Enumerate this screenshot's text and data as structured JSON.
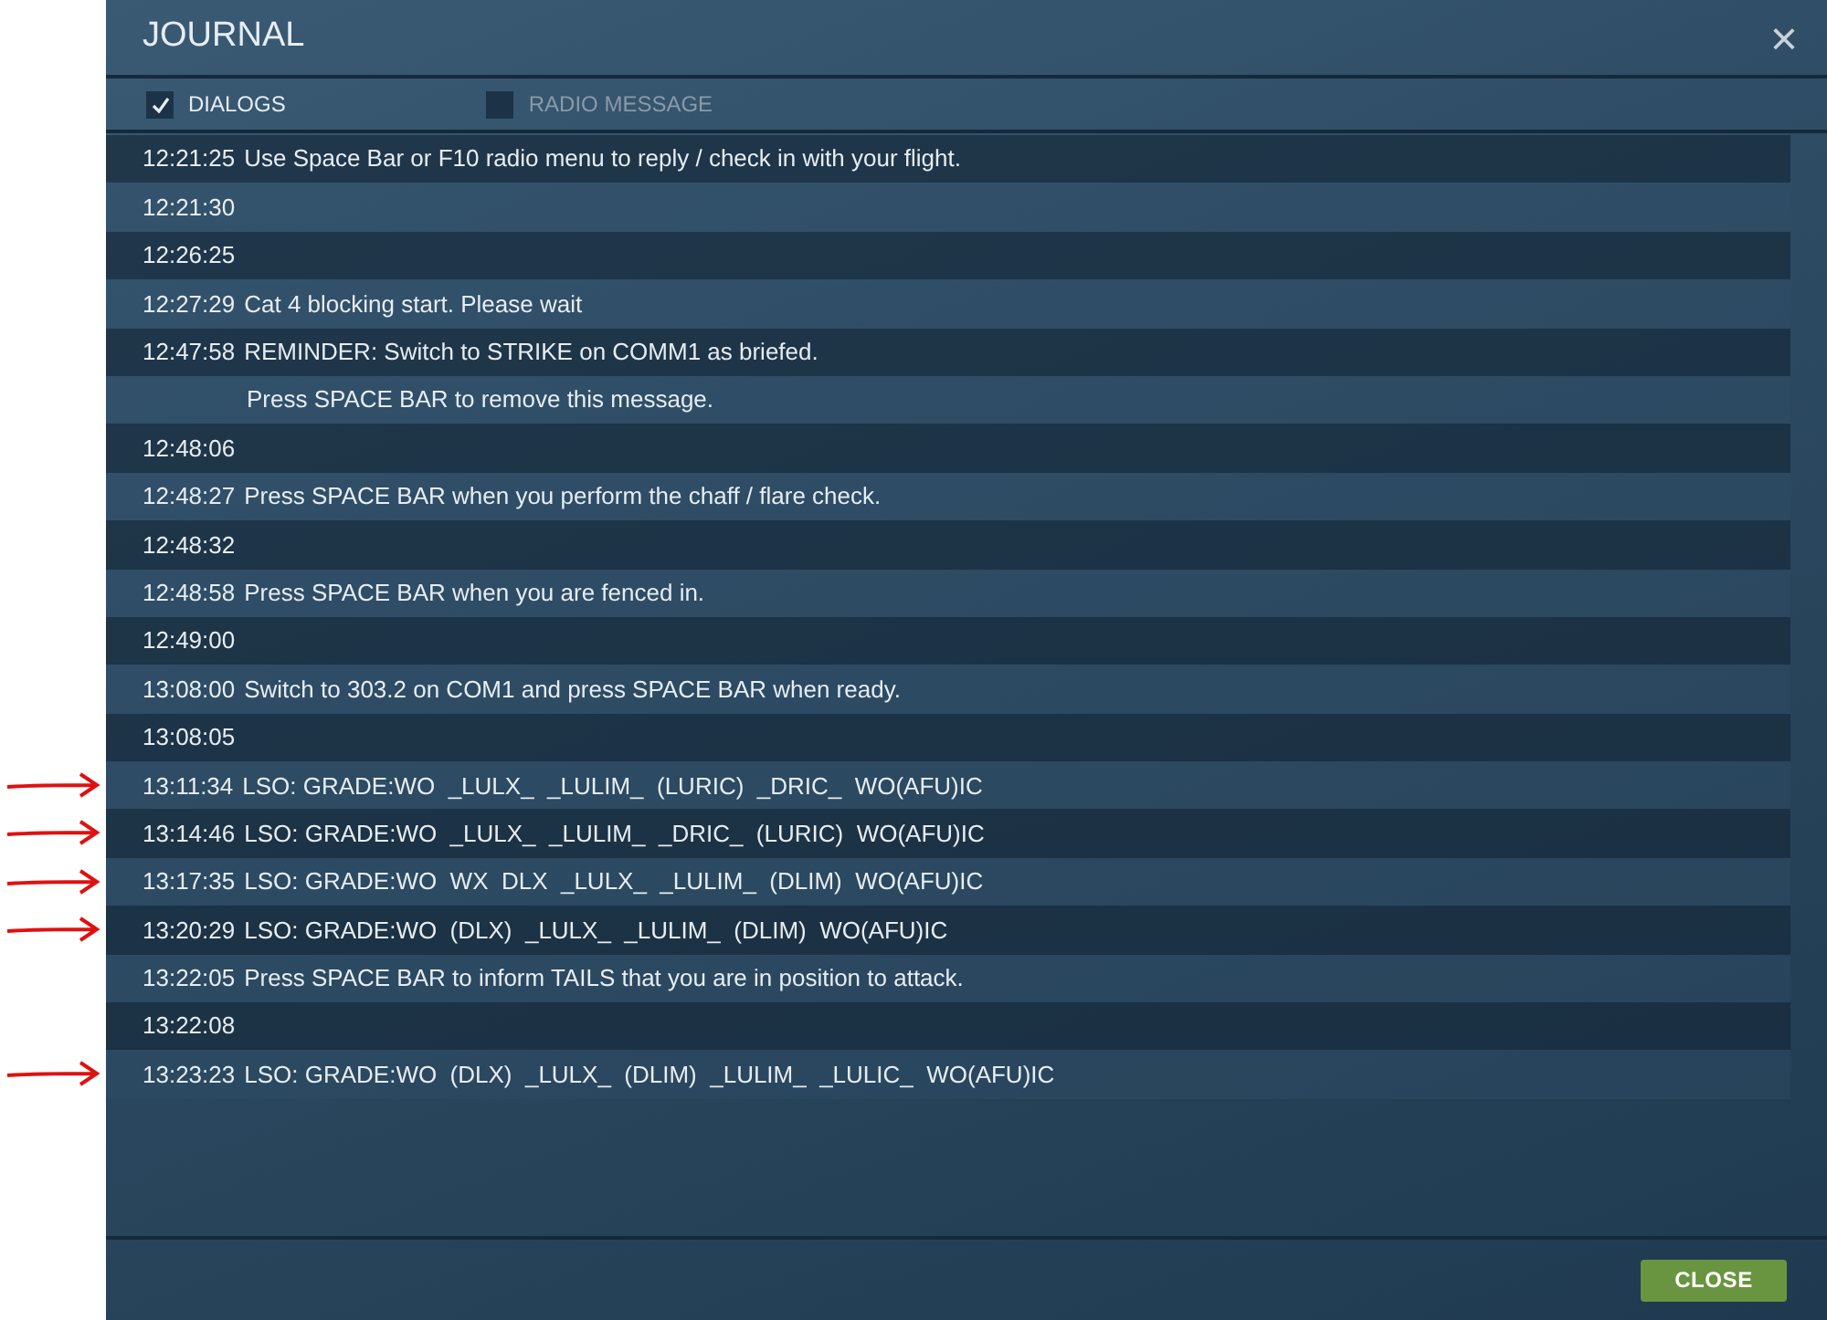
{
  "window": {
    "title": "JOURNAL",
    "close_icon": "×"
  },
  "filters": [
    {
      "label": "DIALOGS",
      "checked": true
    },
    {
      "label": "RADIO MESSAGE",
      "checked": false
    }
  ],
  "entries": [
    {
      "time": "12:21:25",
      "text": "Use Space Bar or F10 radio menu to reply / check in with your flight.",
      "marked": false
    },
    {
      "time": "12:21:30",
      "marked": false
    },
    {
      "time": "12:26:25",
      "marked": false
    },
    {
      "time": "12:27:29",
      "text": "Cat 4 blocking start. Please wait",
      "marked": false
    },
    {
      "time": "12:47:58",
      "text": "REMINDER: Switch to STRIKE on COMM1 as briefed.",
      "marked": false
    },
    {
      "text": "Press SPACE BAR to remove this message.",
      "marked": false
    },
    {
      "time": "12:48:06",
      "marked": false
    },
    {
      "time": "12:48:27",
      "text": "Press SPACE BAR when you perform the chaff / flare check.",
      "marked": false
    },
    {
      "time": "12:48:32",
      "marked": false
    },
    {
      "time": "12:48:58",
      "text": "Press SPACE BAR when you are fenced in.",
      "marked": false
    },
    {
      "time": "12:49:00",
      "marked": false
    },
    {
      "time": "13:08:00",
      "text": "Switch to 303.2 on COM1 and press SPACE BAR when ready.",
      "marked": false
    },
    {
      "time": "13:08:05",
      "marked": false
    },
    {
      "time": "13:11:34",
      "text": "LSO: GRADE:WO  _LULX_  _LULIM_  (LURIC)  _DRIC_  WO(AFU)IC",
      "marked": true
    },
    {
      "time": "13:14:46",
      "text": "LSO: GRADE:WO  _LULX_  _LULIM_  _DRIC_  (LURIC)  WO(AFU)IC",
      "marked": true
    },
    {
      "time": "13:17:35",
      "text": "LSO: GRADE:WO  WX  DLX  _LULX_  _LULIM_  (DLIM)  WO(AFU)IC",
      "marked": true
    },
    {
      "time": "13:20:29",
      "text": "LSO: GRADE:WO  (DLX)  _LULX_  _LULIM_  (DLIM)  WO(AFU)IC",
      "marked": true
    },
    {
      "time": "13:22:05",
      "text": "Press SPACE BAR to inform TAILS that you are in position to attack.",
      "marked": false
    },
    {
      "time": "13:22:08",
      "marked": false
    },
    {
      "time": "13:23:23",
      "text": "LSO: GRADE:WO  (DLX)  _LULX_  (DLIM)  _LULIM_  _LULIC_  WO(AFU)IC",
      "marked": true
    }
  ],
  "footer": {
    "button": "CLOSE"
  }
}
